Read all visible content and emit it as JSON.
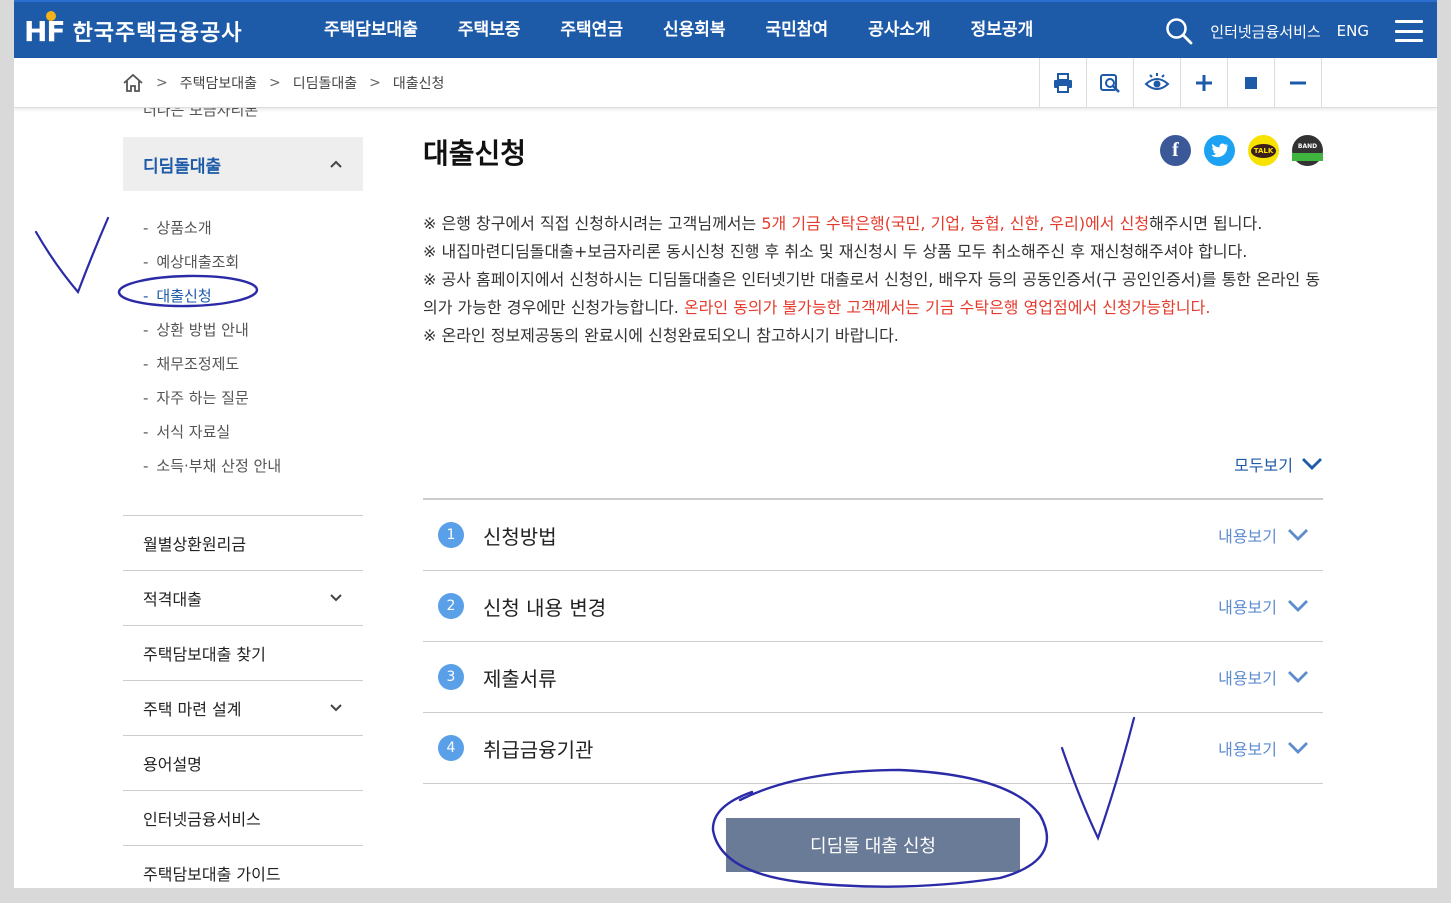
{
  "header": {
    "logo_mark": "HF",
    "logo_name": "한국주택금융공사",
    "menu": [
      "주택담보대출",
      "주택보증",
      "주택연금",
      "신용회복",
      "국민참여",
      "공사소개",
      "정보공개"
    ],
    "internet_service": "인터넷금융서비스",
    "lang": "ENG"
  },
  "breadcrumb": [
    "주택담보대출",
    "디딤돌대출",
    "대출신청"
  ],
  "sidebar": {
    "faded_item": "더나은 보금자리론",
    "active_section": "디딤돌대출",
    "sub_items": [
      "상품소개",
      "예상대출조회",
      "대출신청",
      "상환 방법 안내",
      "채무조정제도",
      "자주 하는 질문",
      "서식 자료실",
      "소득·부채 산정 안내"
    ],
    "items": [
      {
        "label": "월별상환원리금",
        "expandable": false
      },
      {
        "label": "적격대출",
        "expandable": true
      },
      {
        "label": "주택담보대출 찾기",
        "expandable": false
      },
      {
        "label": "주택 마련 설계",
        "expandable": true
      },
      {
        "label": "용어설명",
        "expandable": false
      },
      {
        "label": "인터넷금융서비스",
        "expandable": false
      },
      {
        "label": "주택담보대출 가이드",
        "expandable": false
      }
    ]
  },
  "main": {
    "title": "대출신청",
    "notice": {
      "p1_pre": "※ 은행 창구에서 직접 신청하시려는 고객님께서는 ",
      "p1_red": "5개 기금 수탁은행(국민, 기업, 농협, 신한, 우리)에서 신청",
      "p1_post": "해주시면 됩니다.",
      "p2": "※ 내집마련디딤돌대출+보금자리론 동시신청 진행 후 취소 및 재신청시 두 상품 모두 취소해주신 후 재신청해주셔야 합니다.",
      "p3_pre": "※ 공사 홈페이지에서 신청하시는 디딤돌대출은 인터넷기반 대출로서 신청인, 배우자 등의 공동인증서(구 공인인증서)를 통한 온라인 동의가 가능한 경우에만 신청가능합니다. ",
      "p3_red": "온라인 동의가 불가능한 고객께서는 기금 수탁은행 영업점에서 신청가능합니다.",
      "p4": "※ 온라인 정보제공동의 완료시에 신청완료되오니 참고하시기 바랍니다."
    },
    "view_all": "모두보기",
    "accordion": [
      {
        "num": "1",
        "title": "신청방법",
        "action": "내용보기"
      },
      {
        "num": "2",
        "title": "신청 내용 변경",
        "action": "내용보기"
      },
      {
        "num": "3",
        "title": "제출서류",
        "action": "내용보기"
      },
      {
        "num": "4",
        "title": "취급금융기관",
        "action": "내용보기"
      }
    ],
    "apply_button": "디딤돌 대출 신청"
  },
  "social": {
    "kakao": "TALK",
    "band": "BAND"
  },
  "colors": {
    "brand_blue": "#1d5aa8",
    "accent_red": "#e43b2c",
    "button_gray": "#6a7b97",
    "annotation": "#2b2ba8"
  }
}
